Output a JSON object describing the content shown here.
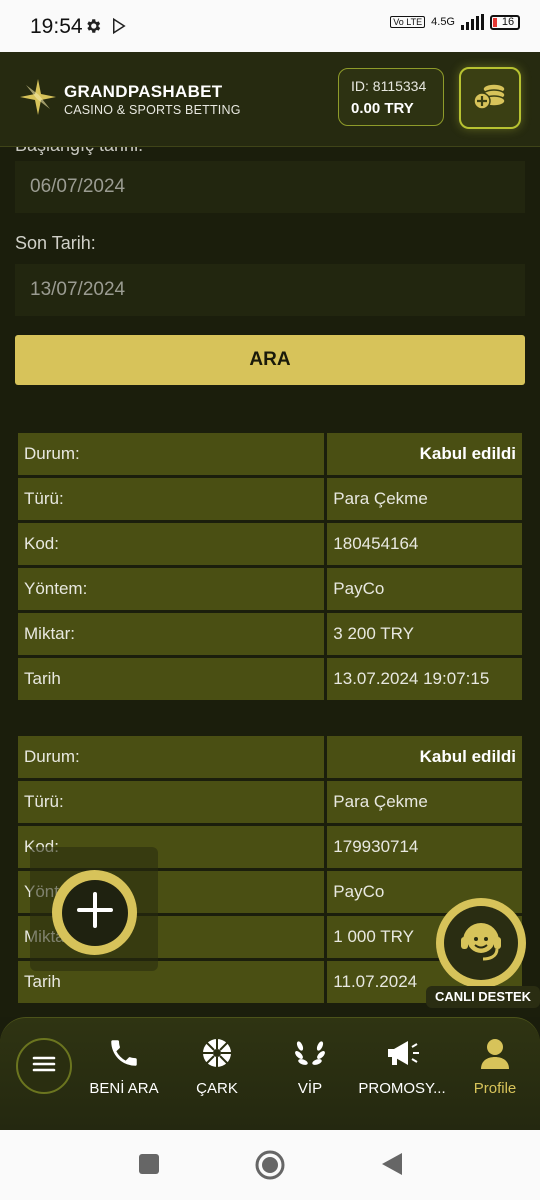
{
  "status_bar": {
    "time": "19:54",
    "network": "4.5G",
    "lte": "Vo LTE",
    "battery": "16"
  },
  "header": {
    "brand": "GRANDPASHABET",
    "tagline": "CASINO & SPORTS BETTING",
    "account_id": "ID: 8115334",
    "balance": "0.00 TRY"
  },
  "filters": {
    "start_label_partial": "Başlangıç tarihi:",
    "start_date": "06/07/2024",
    "end_label": "Son Tarih:",
    "end_date": "13/07/2024",
    "search_button": "ARA"
  },
  "transactions": [
    {
      "rows": [
        {
          "label": "Durum:",
          "value": "Kabul edildi"
        },
        {
          "label": "Türü:",
          "value": "Para Çekme"
        },
        {
          "label": "Kod:",
          "value": "180454164"
        },
        {
          "label": "Yöntem:",
          "value": "PayCo"
        },
        {
          "label": "Miktar:",
          "value": "3 200 TRY"
        },
        {
          "label": "Tarih",
          "value": "13.07.2024 19:07:15"
        }
      ]
    },
    {
      "rows": [
        {
          "label": "Durum:",
          "value": "Kabul edildi"
        },
        {
          "label": "Türü:",
          "value": "Para Çekme"
        },
        {
          "label": "Kod:",
          "value": "179930714"
        },
        {
          "label": "Yöntem:",
          "value": "PayCo"
        },
        {
          "label": "Miktar:",
          "value": "1 000 TRY"
        },
        {
          "label": "Tarih",
          "value": "11.07.2024"
        }
      ]
    }
  ],
  "support": {
    "label": "CANLI DESTEK"
  },
  "bottom_nav": {
    "items": [
      {
        "label": "BENİ ARA",
        "icon": "phone-icon"
      },
      {
        "label": "ÇARK",
        "icon": "wheel-icon"
      },
      {
        "label": "VİP",
        "icon": "laurel-icon"
      },
      {
        "label": "PROMOSY...",
        "icon": "megaphone-icon"
      },
      {
        "label": "Profile",
        "icon": "user-icon"
      }
    ]
  },
  "colors": {
    "accent": "#d7c35a",
    "table_cell": "#4a4f13",
    "background": "#1b1e0c"
  }
}
